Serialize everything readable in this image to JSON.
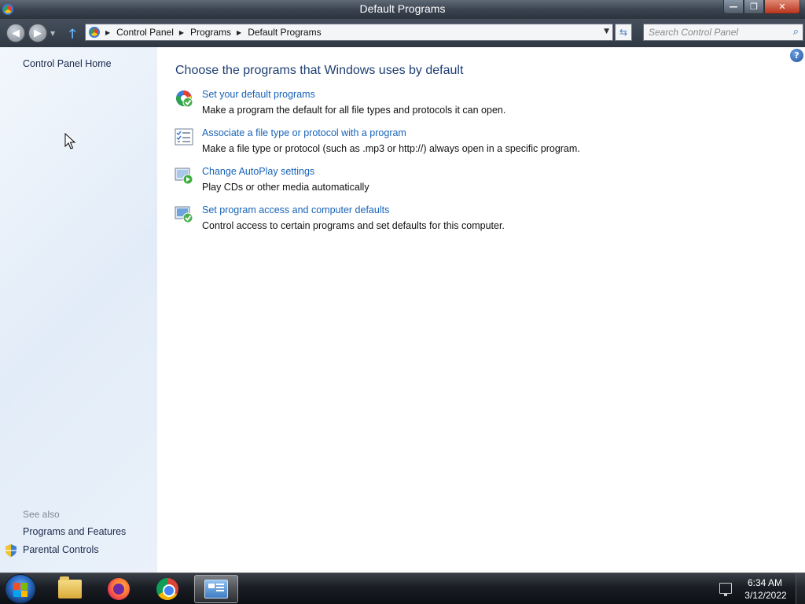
{
  "window": {
    "title": "Default Programs",
    "controls": {
      "minimize": "—",
      "maximize": "❐",
      "close": "✕"
    }
  },
  "navigation": {
    "back_icon": "back-arrow-icon",
    "forward_icon": "forward-arrow-icon",
    "up_icon": "up-arrow-icon",
    "breadcrumbs": [
      "Control Panel",
      "Programs",
      "Default Programs"
    ],
    "search_placeholder": "Search Control Panel"
  },
  "sidebar": {
    "home_label": "Control Panel Home",
    "see_also_label": "See also",
    "links": [
      {
        "label": "Programs and Features",
        "icon": ""
      },
      {
        "label": "Parental Controls",
        "icon": "shield-icon"
      }
    ]
  },
  "main": {
    "heading": "Choose the programs that Windows uses by default",
    "tasks": [
      {
        "link": "Set your default programs",
        "description": "Make a program the default for all file types and protocols it can open.",
        "icon": "default-programs-icon"
      },
      {
        "link": "Associate a file type or protocol with a program",
        "description": "Make a file type or protocol (such as .mp3 or http://) always open in a specific program.",
        "icon": "file-association-icon"
      },
      {
        "link": "Change AutoPlay settings",
        "description": "Play CDs or other media automatically",
        "icon": "autoplay-icon"
      },
      {
        "link": "Set program access and computer defaults",
        "description": "Control access to certain programs and set defaults for this computer.",
        "icon": "program-access-icon"
      }
    ]
  },
  "taskbar": {
    "items": [
      "start-button",
      "file-explorer-icon",
      "firefox-icon",
      "chrome-icon",
      "control-panel-icon"
    ],
    "active_item": "control-panel-icon",
    "clock_time": "6:34 AM",
    "clock_date": "3/12/2022"
  },
  "colors": {
    "link": "#1863b8",
    "heading": "#1e3f73",
    "sidebar_bg": "#e8f0fa"
  }
}
